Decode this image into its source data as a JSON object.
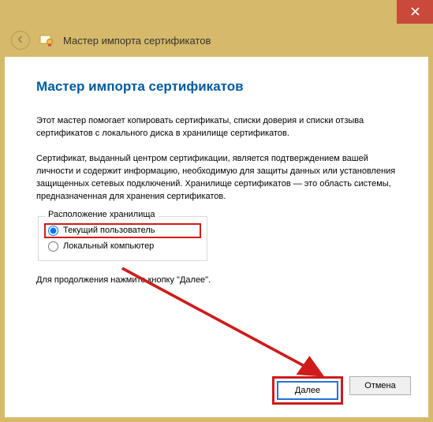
{
  "window": {
    "title": "Мастер импорта сертификатов"
  },
  "page": {
    "heading": "Мастер импорта сертификатов",
    "intro": "Этот мастер помогает копировать сертификаты, списки доверия и списки отзыва сертификатов с локального диска в хранилище сертификатов.",
    "desc": "Сертификат, выданный центром сертификации, является подтверждением вашей личности и содержит информацию, необходимую для защиты данных или установления защищенных сетевых подключений. Хранилище сертификатов — это область системы, предназначенная для хранения сертификатов.",
    "continue_hint": "Для продолжения нажмите кнопку \"Далее\"."
  },
  "store_location": {
    "legend": "Расположение хранилища",
    "options": {
      "current_user": "Текущий пользователь",
      "local_machine": "Локальный компьютер"
    },
    "selected": "current_user"
  },
  "buttons": {
    "next": "Далее",
    "cancel": "Отмена"
  },
  "annotations": {
    "highlight_color": "#cf1b1b"
  }
}
